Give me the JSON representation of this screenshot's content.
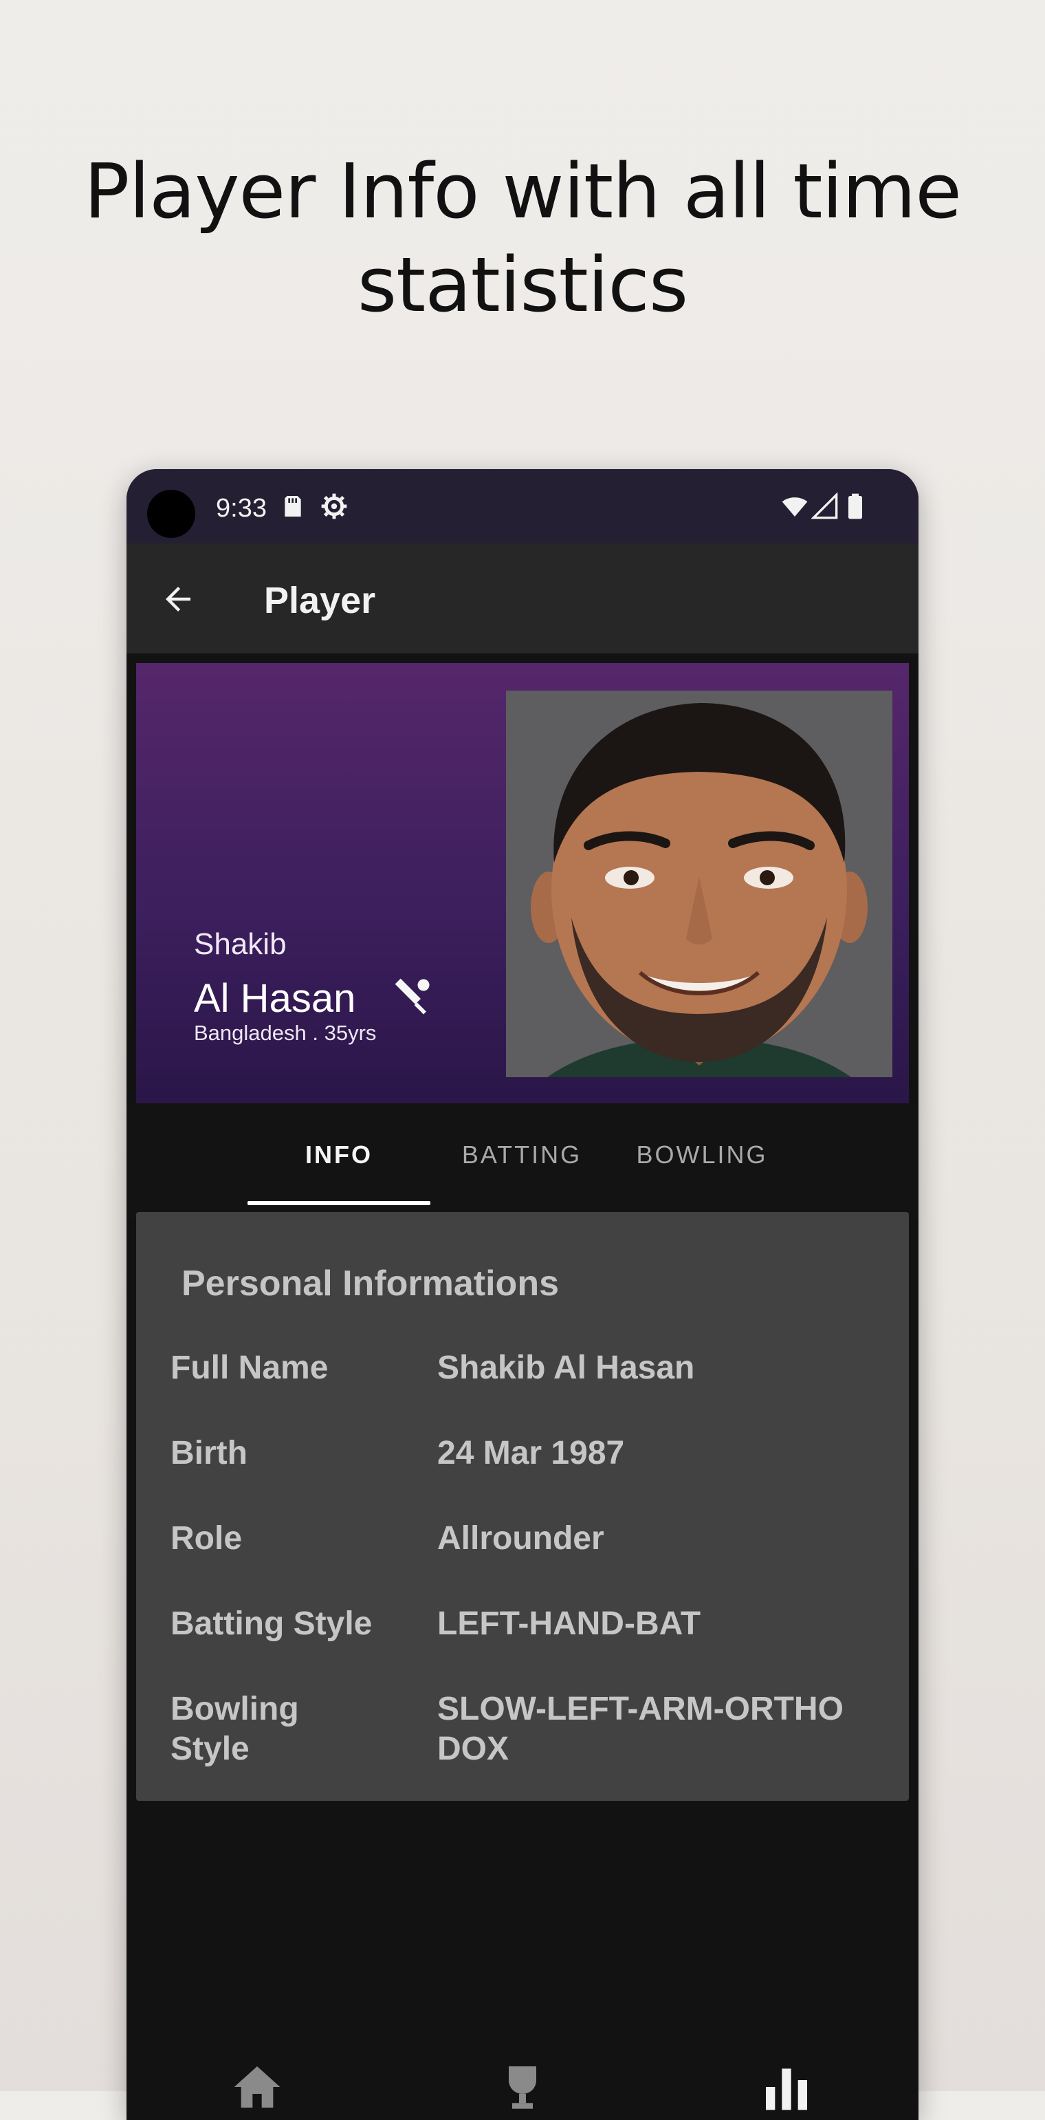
{
  "headline": {
    "line1": "Player Info with all time",
    "line2": "statistics"
  },
  "status_bar": {
    "time": "9:33",
    "icons": [
      "sd-card-icon",
      "settings-gear-icon",
      "wifi-icon",
      "signal-icon",
      "battery-icon"
    ]
  },
  "app_bar": {
    "title": "Player",
    "back_icon": "arrow-left-icon"
  },
  "player": {
    "first_name": "Shakib",
    "last_name": "Al Hasan",
    "meta": "Bangladesh . 35yrs",
    "role_icon": "cricket-bat-ball-icon"
  },
  "tabs": [
    {
      "label": "INFO",
      "active": true
    },
    {
      "label": "BATTING",
      "active": false
    },
    {
      "label": "BOWLING",
      "active": false
    }
  ],
  "personal_info": {
    "title": "Personal Informations",
    "rows": [
      {
        "label": "Full Name",
        "value": "Shakib Al Hasan"
      },
      {
        "label": "Birth",
        "value": "24 Mar 1987"
      },
      {
        "label": "Role",
        "value": "Allrounder"
      },
      {
        "label": "Batting Style",
        "value": "LEFT-HAND-BAT"
      },
      {
        "label": "Bowling Style",
        "value": "SLOW-LEFT-ARM-ORTHODOX"
      }
    ]
  },
  "bottom_nav": {
    "icons": [
      "home-icon",
      "trophy-icon",
      "bar-chart-icon"
    ]
  },
  "colors": {
    "status_bar": "#241f33",
    "app_bar": "#272727",
    "hero_top": "#55276a",
    "hero_bottom": "#2a1648",
    "card": "#424242",
    "background": "#121212"
  }
}
